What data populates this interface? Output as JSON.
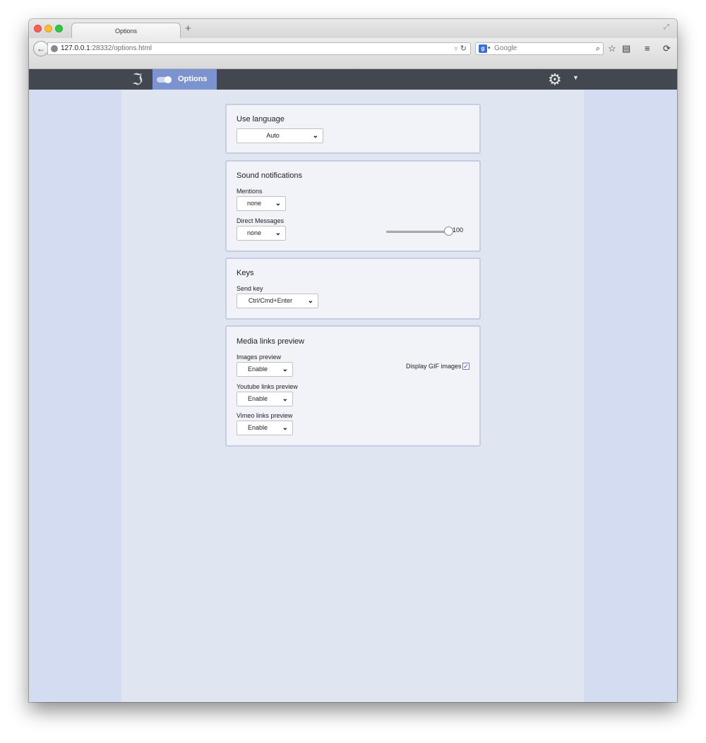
{
  "browser": {
    "tab_title": "Options",
    "new_tab": "+",
    "url_host": "127.0.0.1",
    "url_path": ":28332/options.html",
    "search_placeholder": "Google",
    "search_engine_letter": "g"
  },
  "app": {
    "nav_tab_label": "Options"
  },
  "language_card": {
    "title": "Use language",
    "select_value": "Auto"
  },
  "sound_card": {
    "title": "Sound notifications",
    "mentions_label": "Mentions",
    "mentions_value": "none",
    "dm_label": "Direct Messages",
    "dm_value": "none",
    "volume_value": "100"
  },
  "keys_card": {
    "title": "Keys",
    "send_key_label": "Send key",
    "send_key_value": "Ctrl/Cmd+Enter"
  },
  "media_card": {
    "title": "Media links preview",
    "images_label": "Images preview",
    "images_value": "Enable",
    "youtube_label": "Youtube links preview",
    "youtube_value": "Enable",
    "vimeo_label": "Vimeo links preview",
    "vimeo_value": "Enable",
    "gif_label": "Display GIF images",
    "gif_checked": true
  },
  "icons": {
    "back": "back-arrow-icon",
    "reload": "reload-icon",
    "bookmark": "star-icon",
    "reading_list": "clipboard-icon",
    "menu": "hamburger-menu-icon",
    "sync": "sync-icon",
    "logo": "app-logo-icon",
    "account": "gear-avatar-icon"
  },
  "colors": {
    "appbar": "#424750",
    "active_tab": "#7d93cf",
    "page_bg": "#d4dcf2",
    "column_bg": "#e0e5f2",
    "card_bg": "#f1f3f8"
  }
}
